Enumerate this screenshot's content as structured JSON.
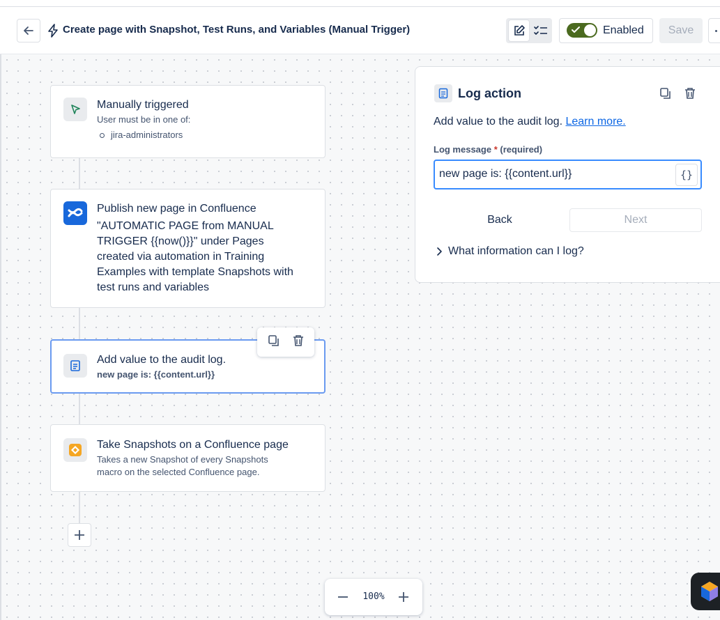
{
  "header": {
    "title": "Create page with Snapshot, Test Runs, and Variables (Manual Trigger)",
    "enabled_label": "Enabled",
    "save_label": "Save"
  },
  "flow": {
    "trigger": {
      "title": "Manually triggered",
      "subtitle": "User must be in one of:",
      "group": "jira-administrators"
    },
    "publish": {
      "lines": [
        "Publish new page in Confluence",
        "\"AUTOMATIC PAGE from MANUAL",
        "TRIGGER {{now()}}\" under Pages",
        "created via automation in Training",
        "Examples with template Snapshots with",
        "test runs and variables"
      ]
    },
    "log": {
      "title": "Add value to the audit log.",
      "subtitle": "new page is: {{content.url}}"
    },
    "snapshot": {
      "title": "Take Snapshots on a Confluence page",
      "desc_line1": "Takes a new Snapshot of every Snapshots",
      "desc_line2": "macro on the selected Confluence page."
    }
  },
  "panel": {
    "title": "Log action",
    "desc": "Add value to the audit log.",
    "learn_more": "Learn more.",
    "field_label": "Log message",
    "required_star": "*",
    "required_text": "(required)",
    "field_value": "new page is: {{content.url}}",
    "braces": "{}",
    "back_label": "Back",
    "next_label": "Next",
    "expand_label": "What information can I log?"
  },
  "zoom": {
    "value": "100%"
  },
  "colors": {
    "accent": "#0c66e4",
    "toggle_on": "#4b6a1f",
    "selected_border": "#6a9af0",
    "confluence_blue": "#1868db",
    "snapshot_orange": "#f5a623"
  }
}
